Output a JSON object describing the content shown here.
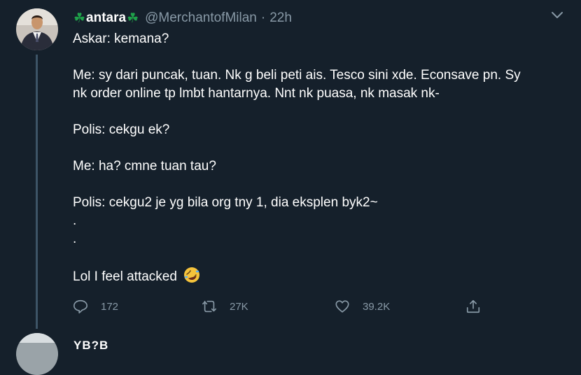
{
  "tweet": {
    "display_name_prefix_icon": "shamrock-icon",
    "display_name": "antara",
    "display_name_suffix_icon": "shamrock-icon",
    "handle": "@MerchantofMilan",
    "separator": "·",
    "timestamp": "22h",
    "lines": [
      "Askar: kemana?",
      "",
      "Me: sy dari puncak, tuan. Nk g beli peti ais. Tesco sini xde. Econsave pn. Sy",
      "nk order online tp lmbt hantarnya. Nnt nk puasa, nk masak nk-",
      "",
      "Polis: cekgu ek?",
      "",
      "Me: ha? cmne tuan tau?",
      "",
      "Polis: cekgu2 je yg bila org tny 1, dia eksplen byk2~",
      ".",
      ".",
      "",
      "Lol I feel attacked"
    ],
    "emoji": "rolling-on-floor-laughing-emoji",
    "reply_count": "172",
    "retweet_count": "27K",
    "like_count": "39.2K"
  },
  "next_tweet": {
    "display_name": "YB?B"
  },
  "colors": {
    "background": "#15202b",
    "secondary_text": "#8899a6",
    "thread_line": "#3d5466",
    "clover": "#1fa24a"
  }
}
